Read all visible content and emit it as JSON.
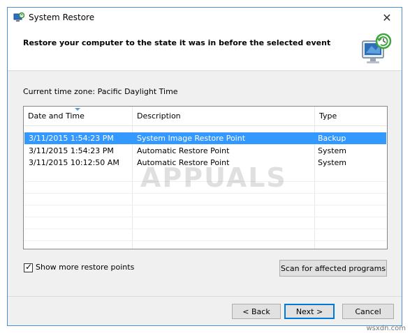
{
  "window": {
    "title": "System Restore",
    "close_glyph": "✕",
    "icon": "system-restore-icon"
  },
  "header": {
    "heading": "Restore your computer to the state it was in before the selected event",
    "icon": "restore-monitor-icon"
  },
  "timezone": {
    "text": "Current time zone: Pacific Daylight Time"
  },
  "list": {
    "columns": [
      "Date and Time",
      "Description",
      "Type"
    ],
    "sorted_column": "Date and Time",
    "rows": [
      {
        "date": "3/11/2015 1:54:23 PM",
        "description": "System Image Restore Point",
        "type": "Backup",
        "selected": true
      },
      {
        "date": "3/11/2015 1:54:23 PM",
        "description": "Automatic Restore Point",
        "type": "System",
        "selected": false
      },
      {
        "date": "3/11/2015 10:12:50 AM",
        "description": "Automatic Restore Point",
        "type": "System",
        "selected": false
      }
    ]
  },
  "watermark": "APPUALS",
  "options": {
    "show_more_label": "Show more restore points",
    "show_more_checked": true,
    "scan_button": "Scan for affected programs"
  },
  "footer": {
    "back": "< Back",
    "next": "Next >",
    "cancel": "Cancel",
    "brand": "wsxdn.com"
  },
  "colors": {
    "selection": "#3399ff",
    "accent": "#0078d7"
  }
}
